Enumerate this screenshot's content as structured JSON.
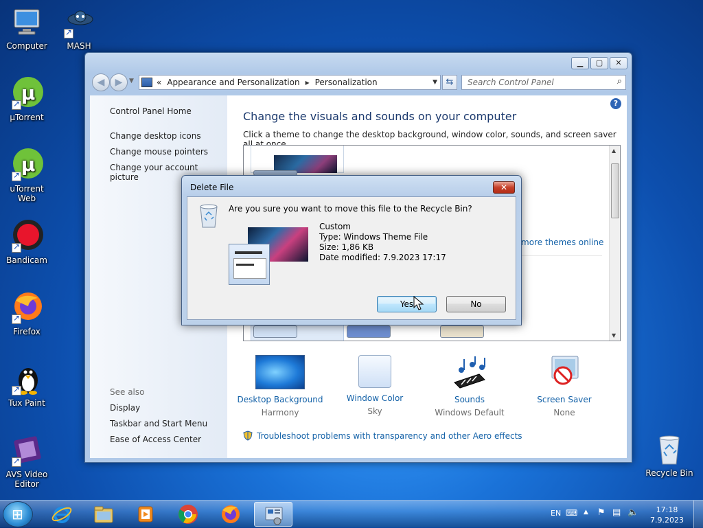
{
  "desktop": {
    "icons": [
      {
        "label": "Computer"
      },
      {
        "label": "MASH"
      },
      {
        "label": "µTorrent"
      },
      {
        "label": "uTorrent Web"
      },
      {
        "label": "Bandicam"
      },
      {
        "label": "Firefox"
      },
      {
        "label": "Tux Paint"
      },
      {
        "label": "AVS Video Editor"
      },
      {
        "label": "Recycle Bin"
      }
    ]
  },
  "window": {
    "breadcrumb": {
      "overflow": "«",
      "items": [
        "Appearance and Personalization",
        "Personalization"
      ]
    },
    "search_placeholder": "Search Control Panel",
    "left_pane": {
      "home": "Control Panel Home",
      "links": [
        "Change desktop icons",
        "Change mouse pointers",
        "Change your account picture"
      ],
      "see_also_title": "See also",
      "see_also": [
        "Display",
        "Taskbar and Start Menu",
        "Ease of Access Center"
      ]
    },
    "heading": "Change the visuals and sounds on your computer",
    "subheading": "Click a theme to change the desktop background, window color, sounds, and screen saver all at once.",
    "more_themes_link": "more themes online",
    "tiles": [
      {
        "label": "Desktop Background",
        "sub": "Harmony",
        "icon": "desktop-background-icon"
      },
      {
        "label": "Window Color",
        "sub": "Sky",
        "icon": "window-color-icon"
      },
      {
        "label": "Sounds",
        "sub": "Windows Default",
        "icon": "sounds-icon"
      },
      {
        "label": "Screen Saver",
        "sub": "None",
        "icon": "screen-saver-icon"
      }
    ],
    "troubleshoot_link": "Troubleshoot problems with transparency and other Aero effects"
  },
  "dialog": {
    "title": "Delete File",
    "question": "Are you sure you want to move this file to the Recycle Bin?",
    "file": {
      "name": "Custom",
      "type": "Type: Windows Theme File",
      "size": "Size: 1,86 KB",
      "modified": "Date modified: 7.9.2023 17:17"
    },
    "yes_label": "Yes",
    "no_label": "No"
  },
  "taskbar": {
    "language": "EN",
    "time": "17:18",
    "date": "7.9.2023",
    "pinned": [
      "internet-explorer-icon",
      "file-explorer-icon",
      "media-player-icon",
      "chrome-icon",
      "firefox-icon",
      "control-panel-icon"
    ]
  },
  "colors": {
    "accent_link": "#1462a8",
    "heading": "#1c3a6e",
    "close_red": "#c7412b"
  }
}
